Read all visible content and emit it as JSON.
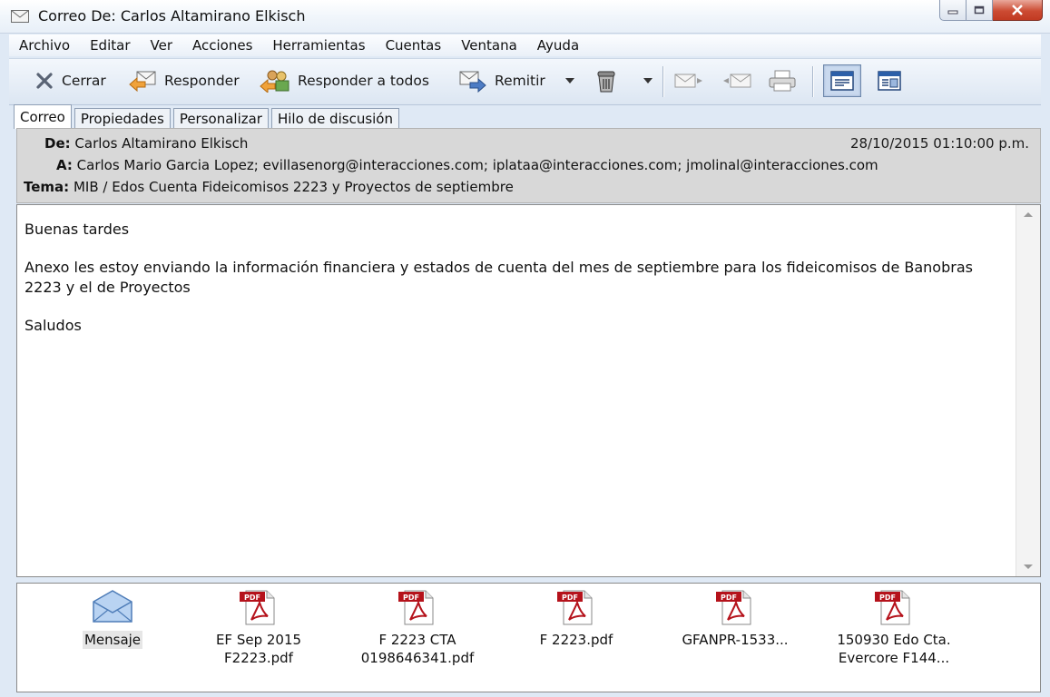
{
  "window": {
    "title": "Correo De: Carlos Altamirano Elkisch"
  },
  "menu": [
    "Archivo",
    "Editar",
    "Ver",
    "Acciones",
    "Herramientas",
    "Cuentas",
    "Ventana",
    "Ayuda"
  ],
  "toolbar": {
    "close_label": "Cerrar",
    "reply_label": "Responder",
    "reply_all_label": "Responder a todos",
    "forward_label": "Remitir"
  },
  "tabs": [
    "Correo",
    "Propiedades",
    "Personalizar",
    "Hilo de discusión"
  ],
  "header": {
    "from_key": "De:",
    "from_value": "Carlos Altamirano Elkisch",
    "date": "28/10/2015 01:10:00 p.m.",
    "to_key": "A:",
    "to_value": "Carlos Mario Garcia Lopez; evillasenorg@interacciones.com; iplataa@interacciones.com; jmolinal@interacciones.com",
    "subject_key": "Tema:",
    "subject_value": "MIB / Edos Cuenta Fideicomisos 2223 y Proyectos de  septiembre"
  },
  "body": {
    "greeting": "Buenas tardes",
    "paragraph": "Anexo les estoy enviando la información financiera y estados de cuenta del mes de septiembre para los fideicomisos de Banobras 2223 y el de Proyectos",
    "closing": "Saludos"
  },
  "attachments": [
    {
      "line1": "Mensaje",
      "line2": ""
    },
    {
      "line1": "EF Sep 2015",
      "line2": "F2223.pdf"
    },
    {
      "line1": "F 2223 CTA",
      "line2": "0198646341.pdf"
    },
    {
      "line1": "F 2223.pdf",
      "line2": ""
    },
    {
      "line1": "GFANPR-1533...",
      "line2": ""
    },
    {
      "line1": "150930 Edo Cta.",
      "line2": "Evercore F144..."
    }
  ],
  "icons": {
    "pdf_badge_text": "PDF",
    "pdf_badge_color": "#b5121b",
    "accent_color": "#3c6fb4"
  }
}
